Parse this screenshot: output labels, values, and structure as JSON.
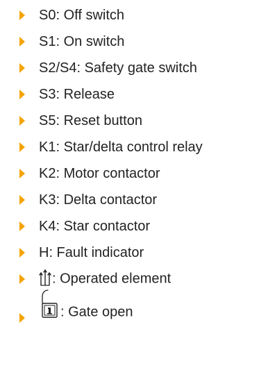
{
  "legend": {
    "bullet_color": "#f5a300",
    "text_color": "#222222",
    "items": [
      {
        "label": "S0: Off switch"
      },
      {
        "label": "S1: On switch"
      },
      {
        "label": "S2/S4: Safety gate switch"
      },
      {
        "label": "S3: Release"
      },
      {
        "label": "S5: Reset button"
      },
      {
        "label": "K1: Star/delta control relay"
      },
      {
        "label": "K2: Motor contactor"
      },
      {
        "label": "K3: Delta contactor"
      },
      {
        "label": "K4: Star contactor"
      },
      {
        "label": "H: Fault indicator"
      },
      {
        "label": ": Operated element",
        "symbol": "operated-element-icon"
      },
      {
        "label": ": Gate open",
        "symbol": "gate-lock-icon"
      }
    ]
  }
}
